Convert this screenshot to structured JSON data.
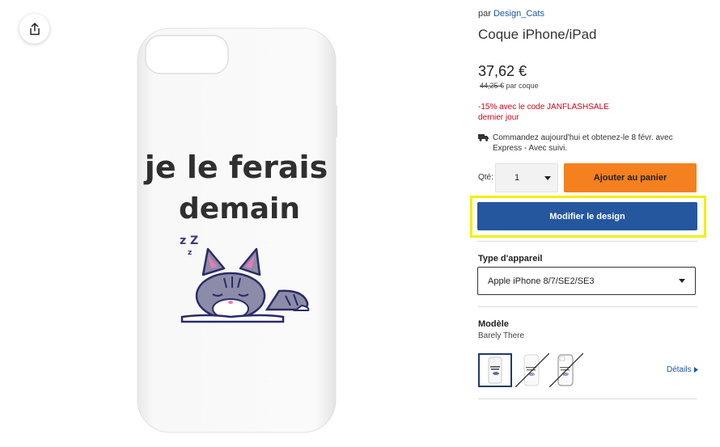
{
  "header": {
    "by_prefix": "par",
    "shop_name": "Design_Cats",
    "title": "Coque iPhone/iPad"
  },
  "pricing": {
    "price": "37,62 €",
    "old_price": "44,25 €",
    "per_unit": "par coque",
    "promo_line1": "-15% avec le code JANFLASHSALE",
    "promo_line2": "dernier jour"
  },
  "delivery": {
    "line1": "Commandez aujourd'hui et obtenez-le 8 févr. avec",
    "line2": "Express - Avec suivi."
  },
  "quantity": {
    "label": "Qté:",
    "value": "1"
  },
  "actions": {
    "add_to_cart": "Ajouter au panier",
    "modify_design": "Modifier le design"
  },
  "device": {
    "label": "Type d'appareil",
    "selected": "Apple iPhone 8/7/SE2/SE3"
  },
  "model": {
    "label": "Modèle",
    "selected": "Barely There",
    "details_link": "Détails"
  },
  "product_image": {
    "text_line1": "je le ferais",
    "text_line2": "demain",
    "zzz": "z Z",
    "zzz_small": "z"
  },
  "colors": {
    "accent_orange": "#f4801f",
    "primary_blue": "#25579e",
    "promo_red": "#d4001a",
    "highlight_yellow": "#f5ee0a",
    "link_blue": "#1a55a8"
  },
  "icons": {
    "share": "share-icon",
    "truck": "truck-icon",
    "caret": "caret-down-icon",
    "details_arrow": "caret-right-icon"
  }
}
